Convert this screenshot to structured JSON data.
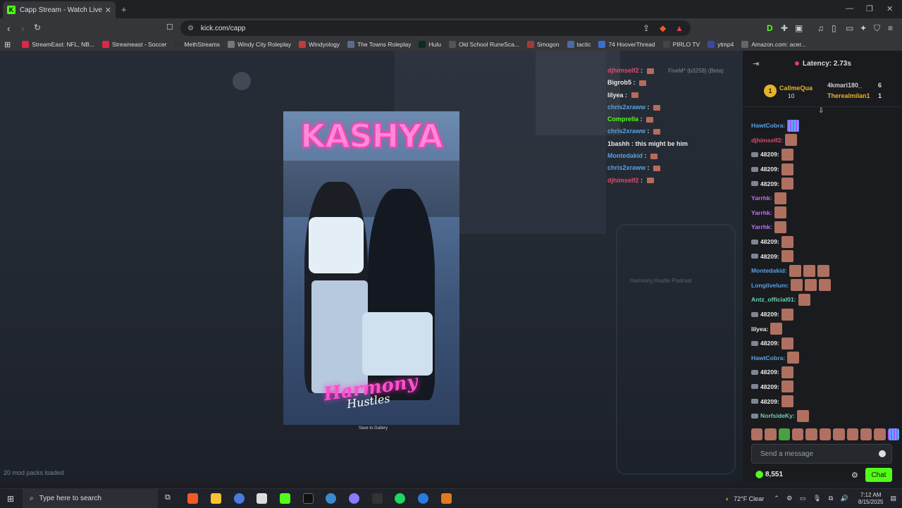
{
  "browser": {
    "tab_title": "Capp Stream - Watch Live on",
    "tab_favicon": "K",
    "new_tab": "+",
    "url": "kick.com/capp",
    "bookmarks": [
      {
        "label": "StreamEast: NFL, NB...",
        "color": "#d62b45"
      },
      {
        "label": "Streameast - Soccer",
        "color": "#d62b45"
      },
      {
        "label": "MethStreams",
        "color": "#333333"
      },
      {
        "label": "Windy City Roleplay",
        "color": "#777777"
      },
      {
        "label": "Windyology",
        "color": "#c23a3a"
      },
      {
        "label": "The Towns Roleplay",
        "color": "#5b6a8a"
      },
      {
        "label": "Hulu",
        "color": "#0d2b1f"
      },
      {
        "label": "Old School RuneSca...",
        "color": "#555555"
      },
      {
        "label": "Smogon",
        "color": "#a33a3a"
      },
      {
        "label": "tactic",
        "color": "#4a6aa0"
      },
      {
        "label": "74 HooverThread",
        "color": "#3a6fd0"
      },
      {
        "label": "PIRLO TV",
        "color": "#444444"
      },
      {
        "label": "ytmp4",
        "color": "#3a4a9a"
      },
      {
        "label": "Amazon.com: acer...",
        "color": "#666666"
      }
    ]
  },
  "stream": {
    "title_text": "KASHYA",
    "logo_text_1": "Harmony",
    "logo_text_2": "Hustles",
    "save_to_gallery": "Save to Gallery",
    "mod_packs": "20 mod packs loaded",
    "fivem_version": "FiveM* (b3258) (Beta)",
    "ghost_title": "Harmony.Hustle Podcast",
    "overlay_chat": [
      {
        "user": "djhimself2",
        "text": "",
        "color": "#e04a6a"
      },
      {
        "user": "Bigrob5",
        "text": "",
        "color": "#e8e8e8"
      },
      {
        "user": "lilyea",
        "text": "",
        "color": "#e8e8e8"
      },
      {
        "user": "chris2xraww",
        "text": "",
        "color": "#5aa0e0"
      },
      {
        "user": "Comprella",
        "text": "",
        "color": "#53fc18"
      },
      {
        "user": "chris2xraww",
        "text": "",
        "color": "#5aa0e0"
      },
      {
        "user": "1bashh",
        "text": "this might be him",
        "color": "#e8e8e8"
      },
      {
        "user": "Montedakid",
        "text": "",
        "color": "#5aa0e0"
      },
      {
        "user": "chris2xraww",
        "text": "",
        "color": "#5aa0e0"
      },
      {
        "user": "djhimself2",
        "text": "",
        "color": "#e04a6a"
      }
    ]
  },
  "chat": {
    "latency": "Latency: 2.73s",
    "leaderboard": [
      {
        "rank": "1",
        "name": "CallmeQua",
        "count": "10"
      },
      {
        "name": "4kmari180_",
        "count": "6"
      },
      {
        "name": "Therealmilan1",
        "count": "1"
      }
    ],
    "messages": [
      {
        "user": "HawtCobra:",
        "color": "#5aa0e0",
        "emotes": 1,
        "grid": true,
        "badge": false
      },
      {
        "user": "djhimself2:",
        "color": "#e04a6a",
        "emotes": 1,
        "badge": false
      },
      {
        "user": "48209:",
        "color": "#e8e8e8",
        "emotes": 1,
        "badge": true
      },
      {
        "user": "48209:",
        "color": "#e8e8e8",
        "emotes": 1,
        "badge": true
      },
      {
        "user": "48209:",
        "color": "#e8e8e8",
        "emotes": 1,
        "badge": true
      },
      {
        "user": "Yarrhk:",
        "color": "#c070ff",
        "emotes": 1,
        "badge": false
      },
      {
        "user": "Yarrhk:",
        "color": "#c070ff",
        "emotes": 1,
        "badge": false
      },
      {
        "user": "Yarrhk:",
        "color": "#c070ff",
        "emotes": 1,
        "badge": false
      },
      {
        "user": "48209:",
        "color": "#e8e8e8",
        "emotes": 1,
        "badge": true
      },
      {
        "user": "48209:",
        "color": "#e8e8e8",
        "emotes": 1,
        "badge": true
      },
      {
        "user": "Montedakid:",
        "color": "#5aa0e0",
        "emotes": 3,
        "badge": false
      },
      {
        "user": "Longlivelum:",
        "color": "#5aa0e0",
        "emotes": 3,
        "badge": false
      },
      {
        "user": "Antz_official01:",
        "color": "#6ad0b0",
        "emotes": 1,
        "badge": false
      },
      {
        "user": "48209:",
        "color": "#e8e8e8",
        "emotes": 1,
        "badge": true
      },
      {
        "user": "lilyea:",
        "color": "#e8e8e8",
        "emotes": 1,
        "badge": false
      },
      {
        "user": "48209:",
        "color": "#e8e8e8",
        "emotes": 1,
        "badge": true
      },
      {
        "user": "HawtCobra:",
        "color": "#5aa0e0",
        "emotes": 1,
        "badge": false
      },
      {
        "user": "48209:",
        "color": "#e8e8e8",
        "emotes": 1,
        "badge": true
      },
      {
        "user": "48209:",
        "color": "#e8e8e8",
        "emotes": 1,
        "badge": true
      },
      {
        "user": "48209:",
        "color": "#e8e8e8",
        "emotes": 1,
        "badge": true
      },
      {
        "user": "NorfsideKy:",
        "color": "#6ad0b0",
        "emotes": 1,
        "badge": true
      }
    ],
    "send_placeholder": "Send a message",
    "points": "8,551",
    "chat_button": "Chat",
    "accent": "#53fc18"
  },
  "taskbar": {
    "search_placeholder": "Type here to search",
    "weather": "72°F  Clear",
    "time": "7:12 AM",
    "date": "8/15/2025"
  }
}
